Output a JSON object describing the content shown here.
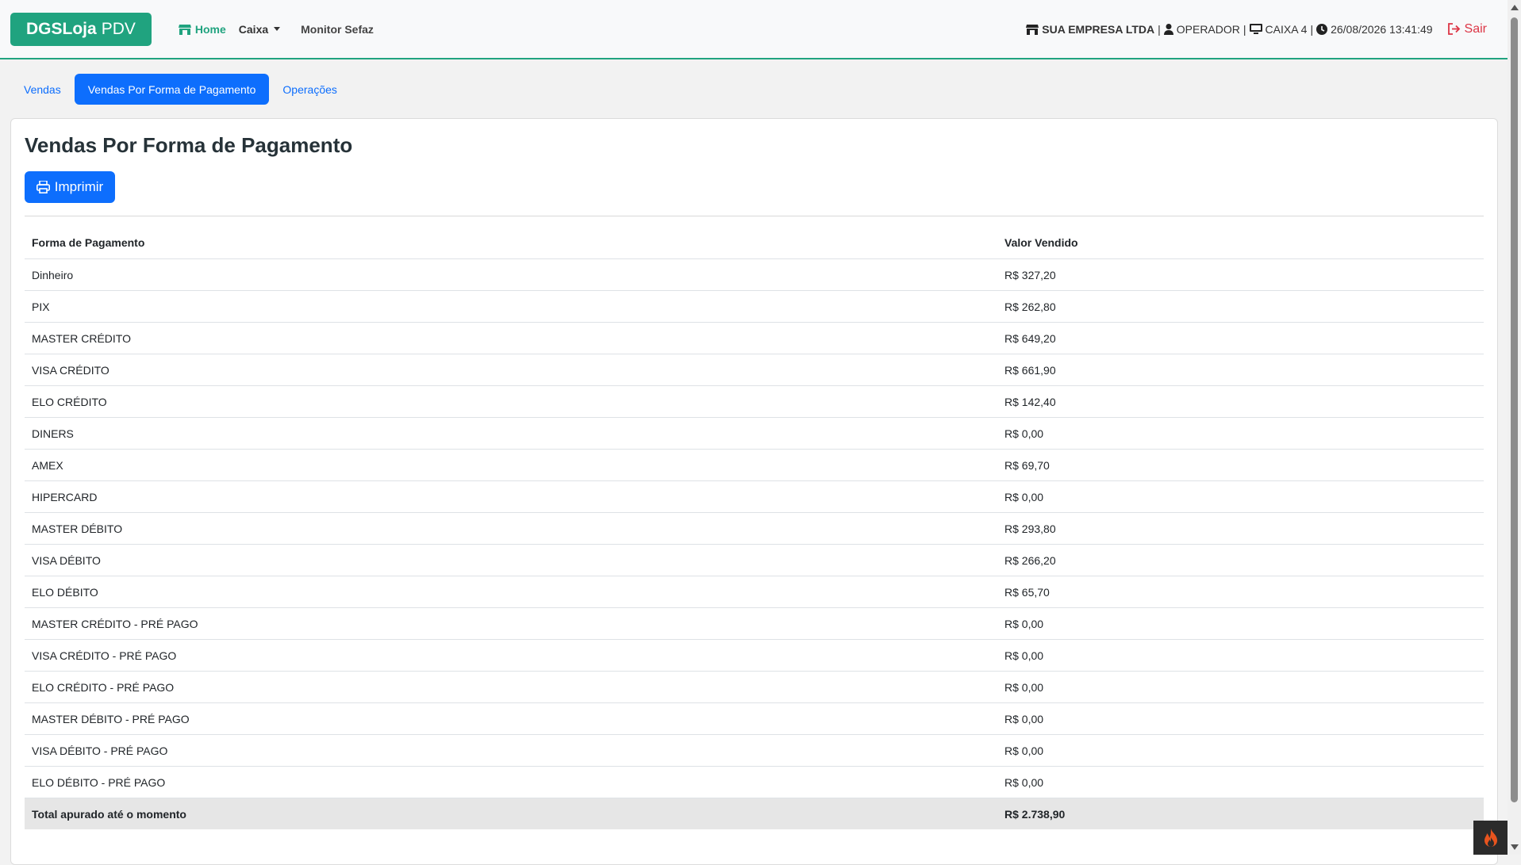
{
  "navbar": {
    "brand_bold": "DGSLoja",
    "brand_light": "PDV",
    "home_label": "Home",
    "caixa_label": "Caixa",
    "monitor_label": "Monitor Sefaz",
    "company": "SUA EMPRESA LTDA",
    "operator": "OPERADOR",
    "register": "CAIXA 4",
    "datetime": "26/08/2026 13:41:49",
    "logout_label": "Sair",
    "separator": "|"
  },
  "tabs": [
    {
      "label": "Vendas",
      "active": false
    },
    {
      "label": "Vendas Por Forma de Pagamento",
      "active": true
    },
    {
      "label": "Operações",
      "active": false
    }
  ],
  "main": {
    "title": "Vendas Por Forma de Pagamento",
    "print_label": "Imprimir",
    "table": {
      "headers": [
        "Forma de Pagamento",
        "Valor Vendido"
      ],
      "rows": [
        [
          "Dinheiro",
          "R$ 327,20"
        ],
        [
          "PIX",
          "R$ 262,80"
        ],
        [
          "MASTER CRÉDITO",
          "R$ 649,20"
        ],
        [
          "VISA CRÉDITO",
          "R$ 661,90"
        ],
        [
          "ELO CRÉDITO",
          "R$ 142,40"
        ],
        [
          "DINERS",
          "R$ 0,00"
        ],
        [
          "AMEX",
          "R$ 69,70"
        ],
        [
          "HIPERCARD",
          "R$ 0,00"
        ],
        [
          "MASTER DÉBITO",
          "R$ 293,80"
        ],
        [
          "VISA DÉBITO",
          "R$ 266,20"
        ],
        [
          "ELO DÉBITO",
          "R$ 65,70"
        ],
        [
          "MASTER CRÉDITO - PRÉ PAGO",
          "R$ 0,00"
        ],
        [
          "VISA CRÉDITO - PRÉ PAGO",
          "R$ 0,00"
        ],
        [
          "ELO CRÉDITO - PRÉ PAGO",
          "R$ 0,00"
        ],
        [
          "MASTER DÉBITO - PRÉ PAGO",
          "R$ 0,00"
        ],
        [
          "VISA DÉBITO - PRÉ PAGO",
          "R$ 0,00"
        ],
        [
          "ELO DÉBITO - PRÉ PAGO",
          "R$ 0,00"
        ]
      ],
      "total_label": "Total apurado até o momento",
      "total_value": "R$ 2.738,90"
    }
  },
  "colors": {
    "brand": "#20a37f",
    "primary": "#0d6efd",
    "danger": "#dc3545"
  },
  "icons": [
    "store-icon",
    "user-icon",
    "monitor-icon",
    "clock-icon",
    "logout-icon",
    "printer-icon",
    "flame-icon"
  ]
}
